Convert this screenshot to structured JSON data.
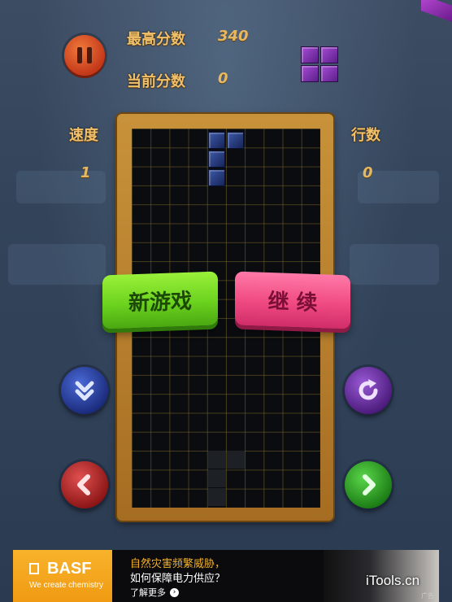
{
  "scores": {
    "high_label": "最高分数",
    "high_value": "340",
    "current_label": "当前分数",
    "current_value": "0"
  },
  "stats": {
    "speed_label": "速度",
    "speed_value": "1",
    "lines_label": "行数",
    "lines_value": "0"
  },
  "buttons": {
    "new_game": "新游戏",
    "continue": "继 续"
  },
  "ad": {
    "brand": "BASF",
    "slogan": "We create chemistry",
    "line1": "自然灾害频繁威胁，",
    "line2": "如何保障电力供应？",
    "more": "了解更多",
    "tag": "广告"
  },
  "watermark": "iTools.cn",
  "colors": {
    "accent_label": "#f0c06a",
    "new_game_button": "#6cd31e",
    "continue_button": "#f04a82",
    "next_piece": "#7a2fb0",
    "active_piece": "#2a3f86"
  },
  "icons": [
    "pause-icon",
    "drop-down-icon",
    "rotate-icon",
    "move-left-icon",
    "move-right-icon"
  ]
}
